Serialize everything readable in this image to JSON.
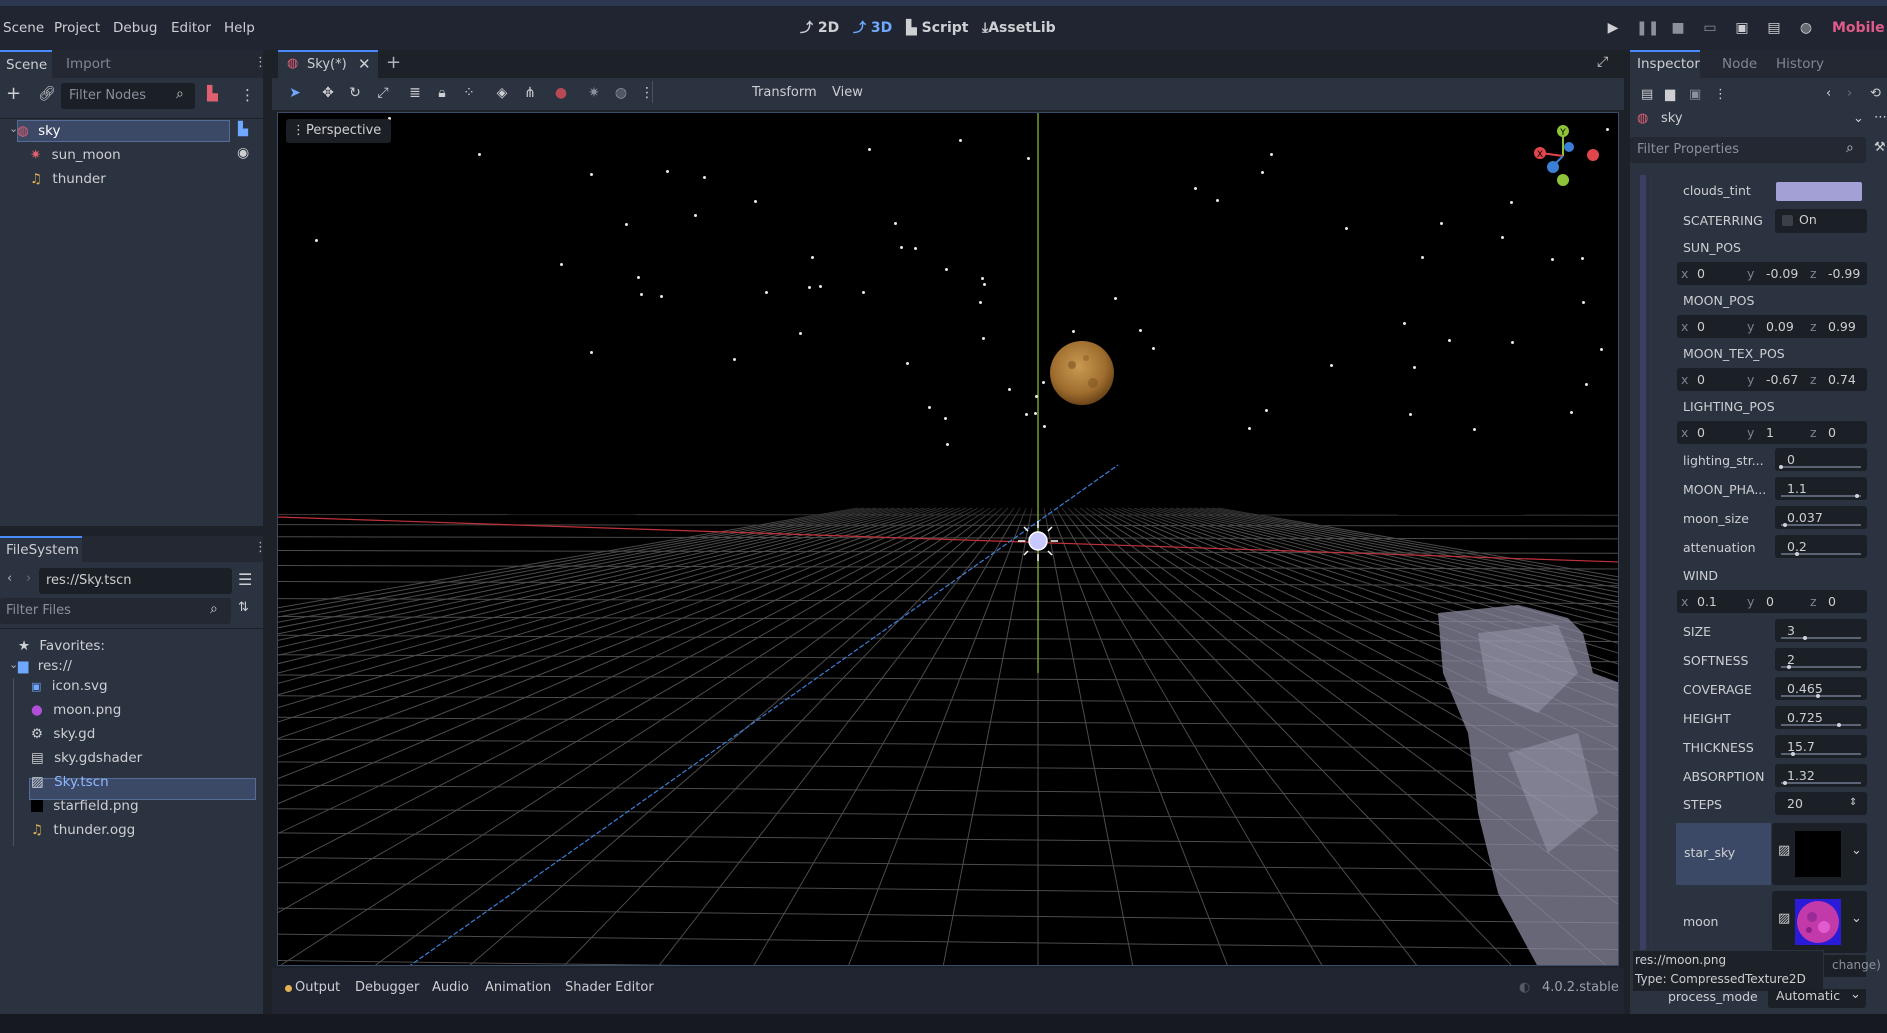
{
  "menu": {
    "items": [
      "Scene",
      "Project",
      "Debug",
      "Editor",
      "Help"
    ]
  },
  "workspaces": {
    "w2d": "2D",
    "w3d": "3D",
    "script": "Script",
    "assetlib": "AssetLib"
  },
  "renderer": "Mobile",
  "scene_dock": {
    "tabs": [
      "Scene",
      "Import"
    ],
    "filter_placeholder": "Filter Nodes",
    "nodes": [
      {
        "name": "sky",
        "icon": "globe-icon",
        "selected": true
      },
      {
        "name": "sun_moon",
        "icon": "sun-icon"
      },
      {
        "name": "thunder",
        "icon": "audio-icon"
      }
    ]
  },
  "filesystem": {
    "title": "FileSystem",
    "path": "res://Sky.tscn",
    "filter_placeholder": "Filter Files",
    "favorites": "Favorites:",
    "root": "res://",
    "files": [
      {
        "name": "icon.svg",
        "icon": "image-icon"
      },
      {
        "name": "moon.png",
        "icon": "texture-icon"
      },
      {
        "name": "sky.gd",
        "icon": "gear-icon"
      },
      {
        "name": "sky.gdshader",
        "icon": "shader-icon"
      },
      {
        "name": "Sky.tscn",
        "icon": "scene-icon",
        "selected": true
      },
      {
        "name": "starfield.png",
        "icon": "texture-icon"
      },
      {
        "name": "thunder.ogg",
        "icon": "audio-icon"
      }
    ]
  },
  "editor_tab": {
    "label": "Sky(*)"
  },
  "viewport": {
    "perspective": "Perspective",
    "toolbar_menus": [
      "Transform",
      "View"
    ]
  },
  "bottom_panel": {
    "tabs": [
      "Output",
      "Debugger",
      "Audio",
      "Animation",
      "Shader Editor"
    ],
    "version": "4.0.2.stable"
  },
  "inspector": {
    "tabs": [
      "Inspector",
      "Node",
      "History"
    ],
    "object": "sky",
    "filter_placeholder": "Filter Properties",
    "clouds_tint_label": "clouds_tint",
    "clouds_tint_color": "#a3a0d6",
    "scaterring": {
      "label": "SCATERRING",
      "value": "On"
    },
    "sun_pos": {
      "label": "SUN_POS",
      "x": "0",
      "y": "-0.09",
      "z": "-0.99"
    },
    "moon_pos": {
      "label": "MOON_POS",
      "x": "0",
      "y": "0.09",
      "z": "0.99"
    },
    "moon_tex_pos": {
      "label": "MOON_TEX_POS",
      "x": "0",
      "y": "-0.67",
      "z": "0.74"
    },
    "lighting_pos": {
      "label": "LIGHTING_POS",
      "x": "0",
      "y": "1",
      "z": "0"
    },
    "scalars": [
      {
        "label": "lighting_str...",
        "value": "0",
        "level": 0
      },
      {
        "label": "MOON_PHA...",
        "value": "1.1",
        "level": 0.95
      },
      {
        "label": "moon_size",
        "value": "0.037",
        "level": 0.05
      },
      {
        "label": "attenuation",
        "value": "0.2",
        "level": 0.2
      }
    ],
    "wind": {
      "label": "WIND",
      "x": "0.1",
      "y": "0",
      "z": "0"
    },
    "scalars2": [
      {
        "label": "SIZE",
        "value": "3",
        "level": 0.3
      },
      {
        "label": "SOFTNESS",
        "value": "2",
        "level": 0.1
      },
      {
        "label": "COVERAGE",
        "value": "0.465",
        "level": 0.46
      },
      {
        "label": "HEIGHT",
        "value": "0.725",
        "level": 0.72
      },
      {
        "label": "THICKNESS",
        "value": "15.7",
        "level": 0.15
      },
      {
        "label": "ABSORPTION",
        "value": "1.32",
        "level": 0.05
      }
    ],
    "steps": {
      "label": "STEPS",
      "value": "20"
    },
    "star_sky": "star_sky",
    "moon": "moon",
    "tooltip": {
      "line1": "res://moon.png",
      "line2": "Type: CompressedTexture2D"
    },
    "change_partial": "change)",
    "process_mode": {
      "label": "process_mode",
      "value": "Automatic"
    }
  },
  "gizmo": {
    "y": "Y",
    "x": "X"
  }
}
